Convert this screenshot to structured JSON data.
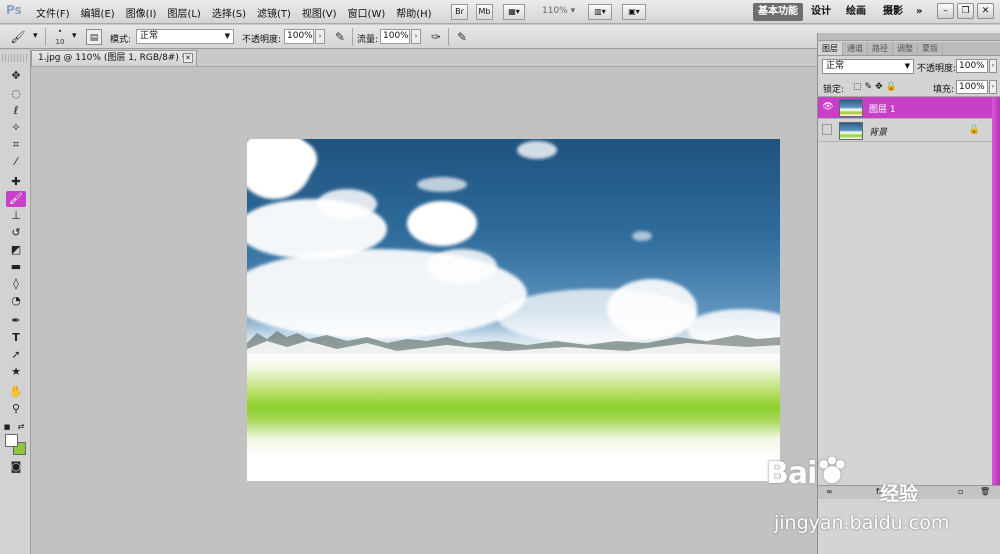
{
  "app": {
    "logo": "Ps"
  },
  "menu": [
    "文件(F)",
    "编辑(E)",
    "图像(I)",
    "图层(L)",
    "选择(S)",
    "滤镜(T)",
    "视图(V)",
    "窗口(W)",
    "帮助(H)"
  ],
  "menubar_tools": {
    "bridge": "Br",
    "minibridge": "Mb",
    "zoom": "110%"
  },
  "workspaces": {
    "active": "基本功能",
    "items": [
      "设计",
      "绘画",
      "摄影"
    ],
    "more": "»"
  },
  "options_bar": {
    "brush_size": "10",
    "mode_label": "模式:",
    "mode_value": "正常",
    "opacity_label": "不透明度:",
    "opacity_value": "100%",
    "flow_label": "流量:",
    "flow_value": "100%"
  },
  "document": {
    "tab_title": "1.jpg @ 110% (图层 1, RGB/8#) *"
  },
  "colors": {
    "foreground": "#ffffff",
    "background": "#8dc63f",
    "accent": "#c840c8"
  },
  "layers_panel": {
    "tabs": [
      "图层",
      "通道",
      "路径",
      "调整",
      "蒙版"
    ],
    "blend_mode": "正常",
    "opacity_label": "不透明度:",
    "opacity_value": "100%",
    "lock_label": "锁定:",
    "fill_label": "填充:",
    "fill_value": "100%",
    "layers": [
      {
        "name": "图层 1",
        "visible": true,
        "selected": true,
        "locked": false
      },
      {
        "name": "背景",
        "visible": false,
        "selected": false,
        "locked": true
      }
    ]
  },
  "watermark": {
    "logo_left": "Bai",
    "logo_right": "经验",
    "url": "jingyan.baidu.com"
  }
}
